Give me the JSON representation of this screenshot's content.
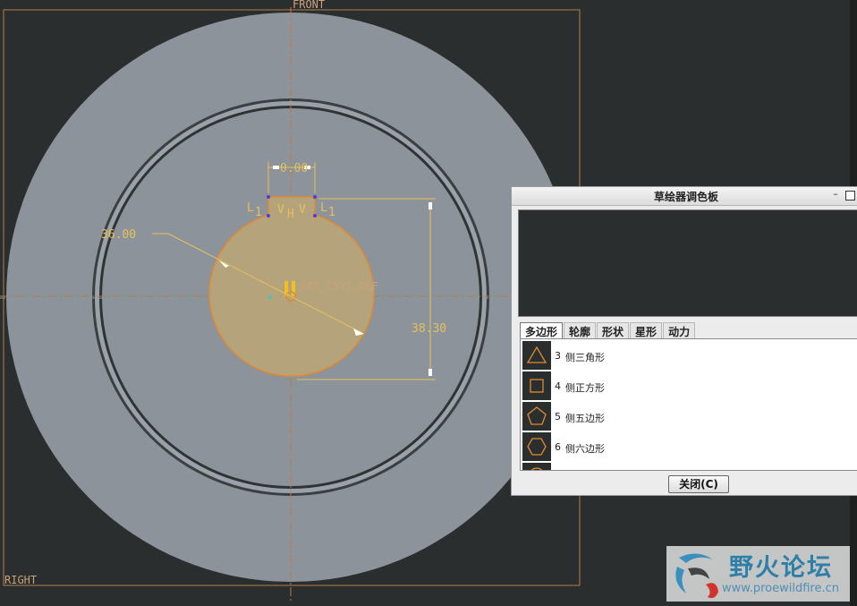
{
  "viewport": {
    "datums": {
      "front": "FRONT",
      "right": "RIGHT",
      "csys": "PRT_CSYS_DEF"
    },
    "dimensions": {
      "width": "0.00",
      "radius": "36.00",
      "height": "38.30"
    },
    "constraints": {
      "l1_left": "L",
      "l1_left_sub": "1",
      "v_left": "V",
      "h": "H",
      "v_right": "V",
      "l1_right": "L",
      "l1_right_sub": "1"
    }
  },
  "palette": {
    "title": "草绘器调色板",
    "min_label": "–",
    "tabs": [
      {
        "label": "多边形",
        "active": true
      },
      {
        "label": "轮廓",
        "active": false
      },
      {
        "label": "形状",
        "active": false
      },
      {
        "label": "星形",
        "active": false
      },
      {
        "label": "动力",
        "active": false
      }
    ],
    "items": [
      {
        "num": "3",
        "label": "侧三角形",
        "icon": "triangle-icon"
      },
      {
        "num": "4",
        "label": "侧正方形",
        "icon": "square-icon"
      },
      {
        "num": "5",
        "label": "侧五边形",
        "icon": "pentagon-icon"
      },
      {
        "num": "6",
        "label": "侧六边形",
        "icon": "hexagon-icon"
      }
    ],
    "close_label": "关闭(C)"
  },
  "watermark": {
    "title": "野火论坛",
    "url": "www.proewildfire.cn"
  },
  "colors": {
    "background": "#2b2e2f",
    "part": "#8c939a",
    "sketch_fill": "#b8a47a",
    "dimension": "#e4c15c",
    "datum": "#c9a27a"
  }
}
